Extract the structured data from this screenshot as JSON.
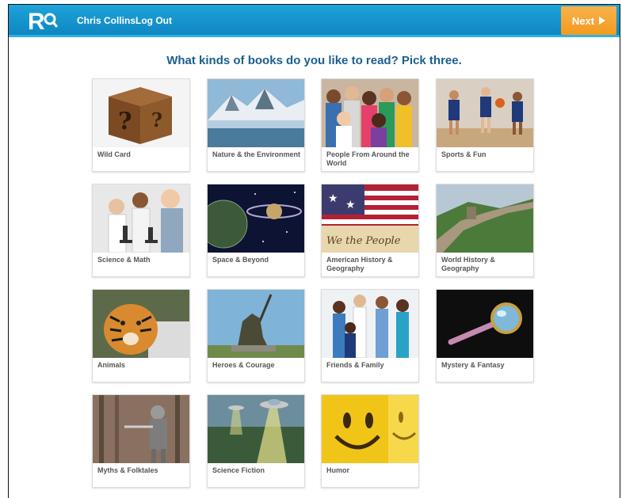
{
  "header": {
    "user_name": "Chris Collins",
    "logout_label": "Log Out",
    "next_label": "Next",
    "logo_text": "R"
  },
  "page": {
    "heading": "What kinds of books do you like to read? Pick three."
  },
  "categories": [
    {
      "label": "Wild Card",
      "icon": "mystery-box"
    },
    {
      "label": "Nature & the Environment",
      "icon": "mountains"
    },
    {
      "label": "People From Around the World",
      "icon": "crowd"
    },
    {
      "label": "Sports & Fun",
      "icon": "basketball-kids"
    },
    {
      "label": "Science & Math",
      "icon": "microscope-students"
    },
    {
      "label": "Space & Beyond",
      "icon": "planets"
    },
    {
      "label": "American History & Geography",
      "icon": "us-flag"
    },
    {
      "label": "World History & Geography",
      "icon": "great-wall"
    },
    {
      "label": "Animals",
      "icon": "tiger"
    },
    {
      "label": "Heroes & Courage",
      "icon": "iwo-jima-statue"
    },
    {
      "label": "Friends & Family",
      "icon": "family"
    },
    {
      "label": "Mystery & Fantasy",
      "icon": "magnifying-glass"
    },
    {
      "label": "Myths & Folktales",
      "icon": "knight"
    },
    {
      "label": "Science Fiction",
      "icon": "ufo"
    },
    {
      "label": "Humor",
      "icon": "smiley-faces"
    }
  ],
  "colors": {
    "header_blue": "#1497d0",
    "next_orange": "#f5a533",
    "heading_blue": "#1c5e8e"
  }
}
